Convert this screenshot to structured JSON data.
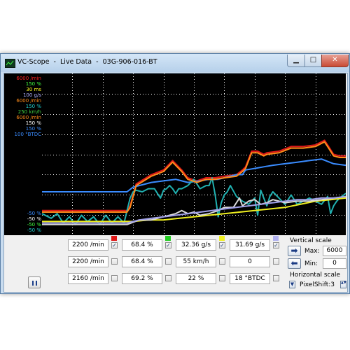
{
  "window": {
    "title": "VC-Scope  -  Live Data  -  03G-906-016-BT",
    "min_icon": "minimize-icon",
    "max_icon": "maximize-icon",
    "close_icon": "close-icon",
    "min_glyph": "▁",
    "max_glyph": "□",
    "close_glyph": "✕"
  },
  "legend": {
    "top": [
      {
        "text": "6000 /min",
        "color": "#ff2020"
      },
      {
        "text": "150 %",
        "color": "#40ff40"
      },
      {
        "text": "30 ms",
        "color": "#ffff20"
      },
      {
        "text": "100 g/s",
        "color": "#b0b0ff"
      },
      {
        "text": "6000 /min",
        "color": "#ff8c1a"
      },
      {
        "text": "150 %",
        "color": "#20d0d0"
      },
      {
        "text": "250 km/h",
        "color": "#40d040"
      },
      {
        "text": "6000 /min",
        "color": "#ff8c1a"
      },
      {
        "text": "150 %",
        "color": "#ffffff"
      },
      {
        "text": "150 %",
        "color": "#3a8cff"
      },
      {
        "text": "100 °BTDC",
        "color": "#3a8cff"
      }
    ],
    "bottom": [
      {
        "text": "-50 %",
        "color": "#3a8cff"
      },
      {
        "text": "-50 %",
        "color": "#ffffff"
      },
      {
        "text": "-50 %",
        "color": "#40ff40"
      },
      {
        "text": "-50 %",
        "color": "#20d0d0"
      }
    ]
  },
  "chart_data": {
    "type": "line",
    "x_range": [
      0,
      100
    ],
    "y_range": [
      0,
      100
    ],
    "grid": true,
    "series": [
      {
        "color": "#e01818",
        "x": [
          0,
          28,
          29,
          31,
          36,
          40,
          43,
          46,
          48,
          51,
          54,
          57,
          60,
          64,
          66,
          67,
          69,
          71,
          73,
          74,
          78,
          82,
          86,
          90,
          92,
          93,
          94,
          96,
          98,
          100
        ],
        "y": [
          14,
          14,
          17,
          31,
          37,
          40,
          46,
          40,
          35,
          33,
          35,
          35,
          36,
          37,
          40,
          42,
          52,
          52,
          50,
          51,
          52,
          55,
          55,
          56,
          58,
          59,
          56,
          50,
          49,
          49
        ]
      },
      {
        "color": "#3a8cff",
        "x": [
          0,
          28,
          30,
          32,
          34,
          36,
          40,
          44,
          46,
          48,
          52,
          55,
          58,
          60,
          62,
          64,
          66,
          67,
          70,
          73,
          76,
          80,
          84,
          88,
          92,
          96,
          100
        ],
        "y": [
          26,
          26,
          29,
          30,
          31,
          32,
          33,
          34,
          33,
          32,
          33,
          34,
          34,
          35,
          36,
          37,
          37,
          40,
          41,
          42,
          43,
          44,
          45,
          46,
          47,
          44,
          43
        ]
      },
      {
        "color": "#20b0b0",
        "x": [
          0,
          3,
          5,
          7,
          9,
          11,
          13,
          15,
          17,
          19,
          21,
          23,
          25,
          27,
          28,
          29,
          30,
          31,
          33,
          35,
          37,
          38,
          39,
          40,
          41,
          42,
          43,
          44,
          45,
          46,
          48,
          50,
          52,
          54,
          55,
          56,
          57,
          58,
          59,
          60,
          61,
          62,
          64,
          66,
          68,
          70,
          71,
          72,
          73,
          74,
          75,
          76,
          77,
          78,
          80,
          82,
          84,
          86,
          88,
          90,
          92,
          94,
          95,
          96,
          97,
          98,
          100
        ],
        "y": [
          12,
          9,
          12,
          6,
          10,
          5,
          11,
          7,
          10,
          5,
          11,
          6,
          10,
          6,
          14,
          22,
          26,
          27,
          26,
          28,
          28,
          25,
          22,
          27,
          28,
          30,
          28,
          25,
          28,
          28,
          30,
          34,
          28,
          30,
          30,
          35,
          24,
          10,
          19,
          24,
          26,
          30,
          23,
          20,
          18,
          22,
          11,
          27,
          22,
          17,
          23,
          26,
          24,
          22,
          18,
          24,
          18,
          20,
          22,
          20,
          18,
          23,
          12,
          17,
          20,
          22,
          25
        ]
      },
      {
        "color": "#f0f020",
        "x": [
          0,
          30,
          35,
          40,
          45,
          50,
          55,
          60,
          65,
          70,
          75,
          80,
          85,
          90,
          95,
          100
        ],
        "y": [
          7,
          7,
          8,
          8,
          9,
          10,
          11,
          12,
          13,
          14,
          15,
          16,
          18,
          20,
          21,
          22
        ]
      },
      {
        "color": "#d8d8d8",
        "x": [
          0,
          28,
          32,
          36,
          40,
          44,
          46,
          48,
          50,
          52,
          55,
          58,
          60,
          63,
          65,
          66,
          68,
          70,
          72,
          74,
          76,
          78,
          80,
          84,
          88,
          92,
          96,
          100
        ],
        "y": [
          5,
          5,
          8,
          8,
          10,
          12,
          14,
          12,
          13,
          11,
          12,
          14,
          16,
          16,
          22,
          17,
          20,
          21,
          18,
          19,
          21,
          20,
          19,
          20,
          20,
          21,
          22,
          23
        ]
      },
      {
        "color": "#a0a0e8",
        "x": [
          0,
          28,
          32,
          36,
          40,
          44,
          48,
          52,
          56,
          60,
          64,
          68,
          72,
          76,
          80,
          84,
          88,
          92,
          96,
          100
        ],
        "y": [
          6,
          6,
          8,
          9,
          10,
          11,
          12,
          13,
          14,
          15,
          16,
          17,
          18,
          19,
          20,
          21,
          21,
          22,
          22,
          23
        ]
      },
      {
        "color": "#ff8c1a",
        "x": [
          0,
          28,
          29,
          31,
          36,
          40,
          43,
          46,
          48,
          51,
          54,
          57,
          60,
          64,
          66,
          67,
          69,
          71,
          73,
          74,
          78,
          82,
          86,
          90,
          92,
          93,
          94,
          96,
          98,
          100
        ],
        "y": [
          13,
          13,
          16,
          30,
          36,
          39,
          45,
          39,
          34,
          32,
          34,
          34,
          35,
          36,
          39,
          41,
          51,
          51,
          49,
          50,
          51,
          54,
          54,
          55,
          57,
          58,
          55,
          49,
          48,
          48
        ]
      }
    ]
  },
  "rows": [
    [
      {
        "value": "2200 /min",
        "swatch": "#e01818",
        "checked": true
      },
      {
        "value": "68.4 %",
        "swatch": "#22cc22",
        "checked": true
      },
      {
        "value": "32.36 g/s",
        "swatch": "#f0f020",
        "checked": true
      },
      {
        "value": "31.69 g/s",
        "swatch": "#b0b0f0",
        "checked": true
      }
    ],
    [
      {
        "value": "2200 /min",
        "swatch": "",
        "checked": false
      },
      {
        "value": "68.4 %",
        "swatch": "",
        "checked": false
      },
      {
        "value": "55 km/h",
        "swatch": "",
        "checked": false
      },
      {
        "value": "0",
        "swatch": "",
        "checked": false
      }
    ],
    [
      {
        "value": "2160 /min",
        "swatch": "",
        "checked": false
      },
      {
        "value": "69.2 %",
        "swatch": "",
        "checked": false
      },
      {
        "value": "22 %",
        "swatch": "",
        "checked": false
      },
      {
        "value": "18 °BTDC",
        "swatch": "",
        "checked": false
      }
    ]
  ],
  "check_glyph": "✓",
  "controls": {
    "pause_icon": "pause-icon",
    "vertical_scale_label": "Vertical scale",
    "max_label": "Max:",
    "max_value": "6000",
    "min_label": "Min:",
    "min_value": "0",
    "right_arrow": "➡",
    "left_arrow": "⬅",
    "horizontal_scale_label": "Horizontal scale",
    "pixel_shift_label": "PixelShift:3",
    "down_glyph": "▼",
    "updown_glyph": "▲▼"
  }
}
